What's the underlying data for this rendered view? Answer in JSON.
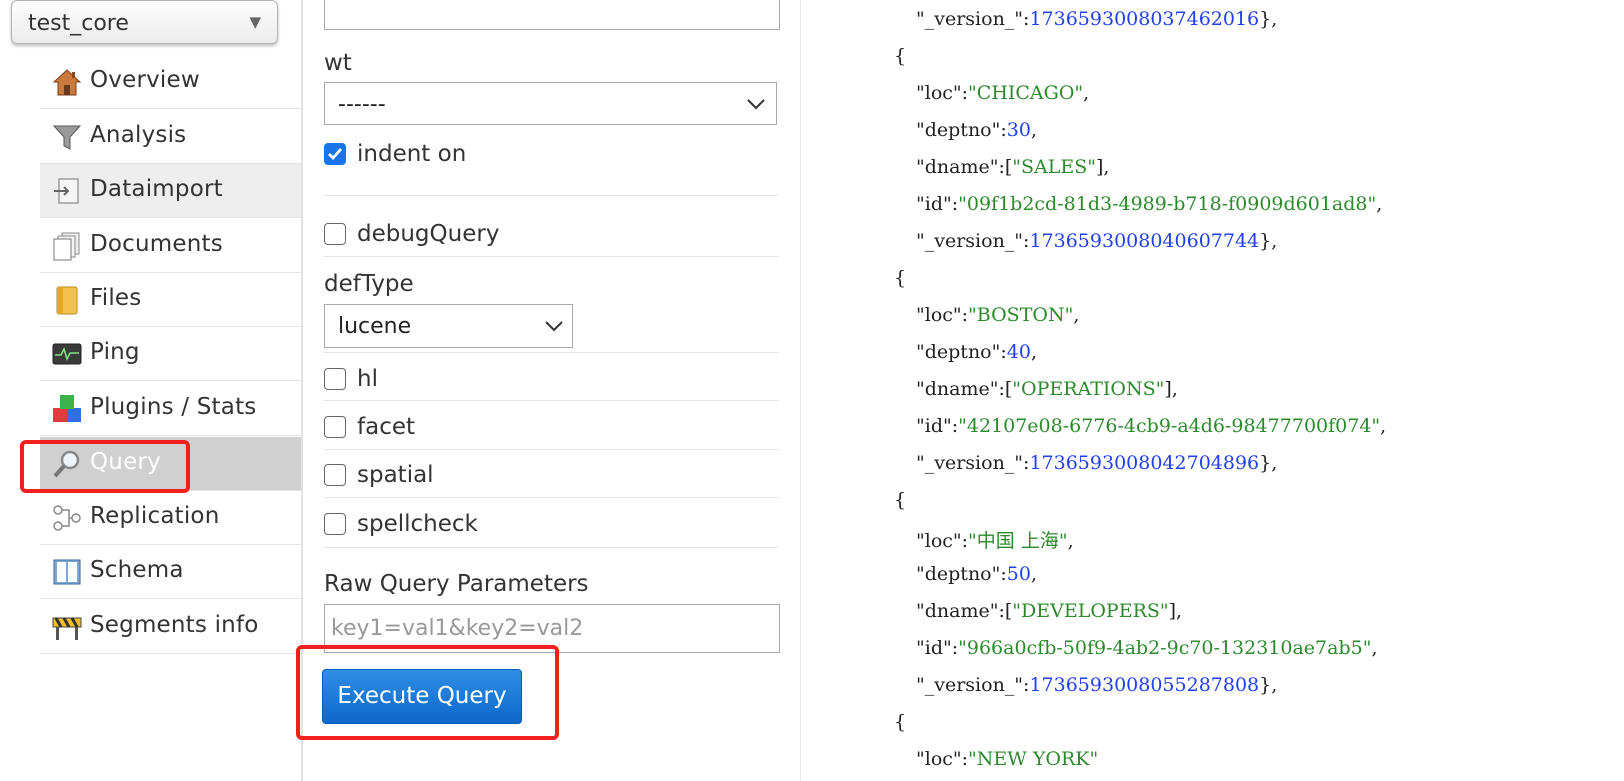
{
  "core_selector": {
    "value": "test_core"
  },
  "nav": [
    {
      "label": "Overview",
      "icon": "house-icon"
    },
    {
      "label": "Analysis",
      "icon": "funnel-icon"
    },
    {
      "label": "Dataimport",
      "icon": "import-icon"
    },
    {
      "label": "Documents",
      "icon": "documents-icon"
    },
    {
      "label": "Files",
      "icon": "folder-icon"
    },
    {
      "label": "Ping",
      "icon": "monitor-icon"
    },
    {
      "label": "Plugins / Stats",
      "icon": "blocks-icon"
    },
    {
      "label": "Query",
      "icon": "magnifier-icon",
      "active": true
    },
    {
      "label": "Replication",
      "icon": "replication-icon"
    },
    {
      "label": "Schema",
      "icon": "book-icon"
    },
    {
      "label": "Segments info",
      "icon": "barrier-icon"
    }
  ],
  "form": {
    "wt_label": "wt",
    "wt_value": "------",
    "indent_label": "indent on",
    "indent_checked": true,
    "debug_label": "debugQuery",
    "deftype_label": "defType",
    "deftype_value": "lucene",
    "hl_label": "hl",
    "facet_label": "facet",
    "spatial_label": "spatial",
    "spellcheck_label": "spellcheck",
    "raw_label": "Raw Query Parameters",
    "raw_placeholder": "key1=val1&key2=val2",
    "execute_label": "Execute Query"
  },
  "json_result": {
    "partial_top": {
      "key": "\"_version_\"",
      "value": "1736593008037462016"
    },
    "docs": [
      {
        "loc": "\"CHICAGO\"",
        "deptno": "30",
        "dname": "\"SALES\"",
        "id": "\"09f1b2cd-81d3-4989-b718-f0909d601ad8\"",
        "version": "1736593008040607744"
      },
      {
        "loc": "\"BOSTON\"",
        "deptno": "40",
        "dname": "\"OPERATIONS\"",
        "id": "\"42107e08-6776-4cb9-a4d6-98477700f074\"",
        "version": "1736593008042704896"
      },
      {
        "loc": "\"中国 上海\"",
        "deptno": "50",
        "dname": "\"DEVELOPERS\"",
        "id": "\"966a0cfb-50f9-4ab2-9c70-132310ae7ab5\"",
        "version": "1736593008055287808"
      }
    ],
    "partial_bottom_key": "\"loc\"",
    "partial_bottom_value": "\"NEW YORK\"",
    "keys": {
      "loc": "\"loc\"",
      "deptno": "\"deptno\"",
      "dname": "\"dname\"",
      "id": "\"id\"",
      "version": "\"_version_\""
    }
  },
  "colors": {
    "active_nav": "#d0d0d0",
    "highlight_red": "#f02020",
    "button_blue": "#0d67c9",
    "json_string": "#2b8a2b",
    "json_number": "#1f3ff0"
  }
}
